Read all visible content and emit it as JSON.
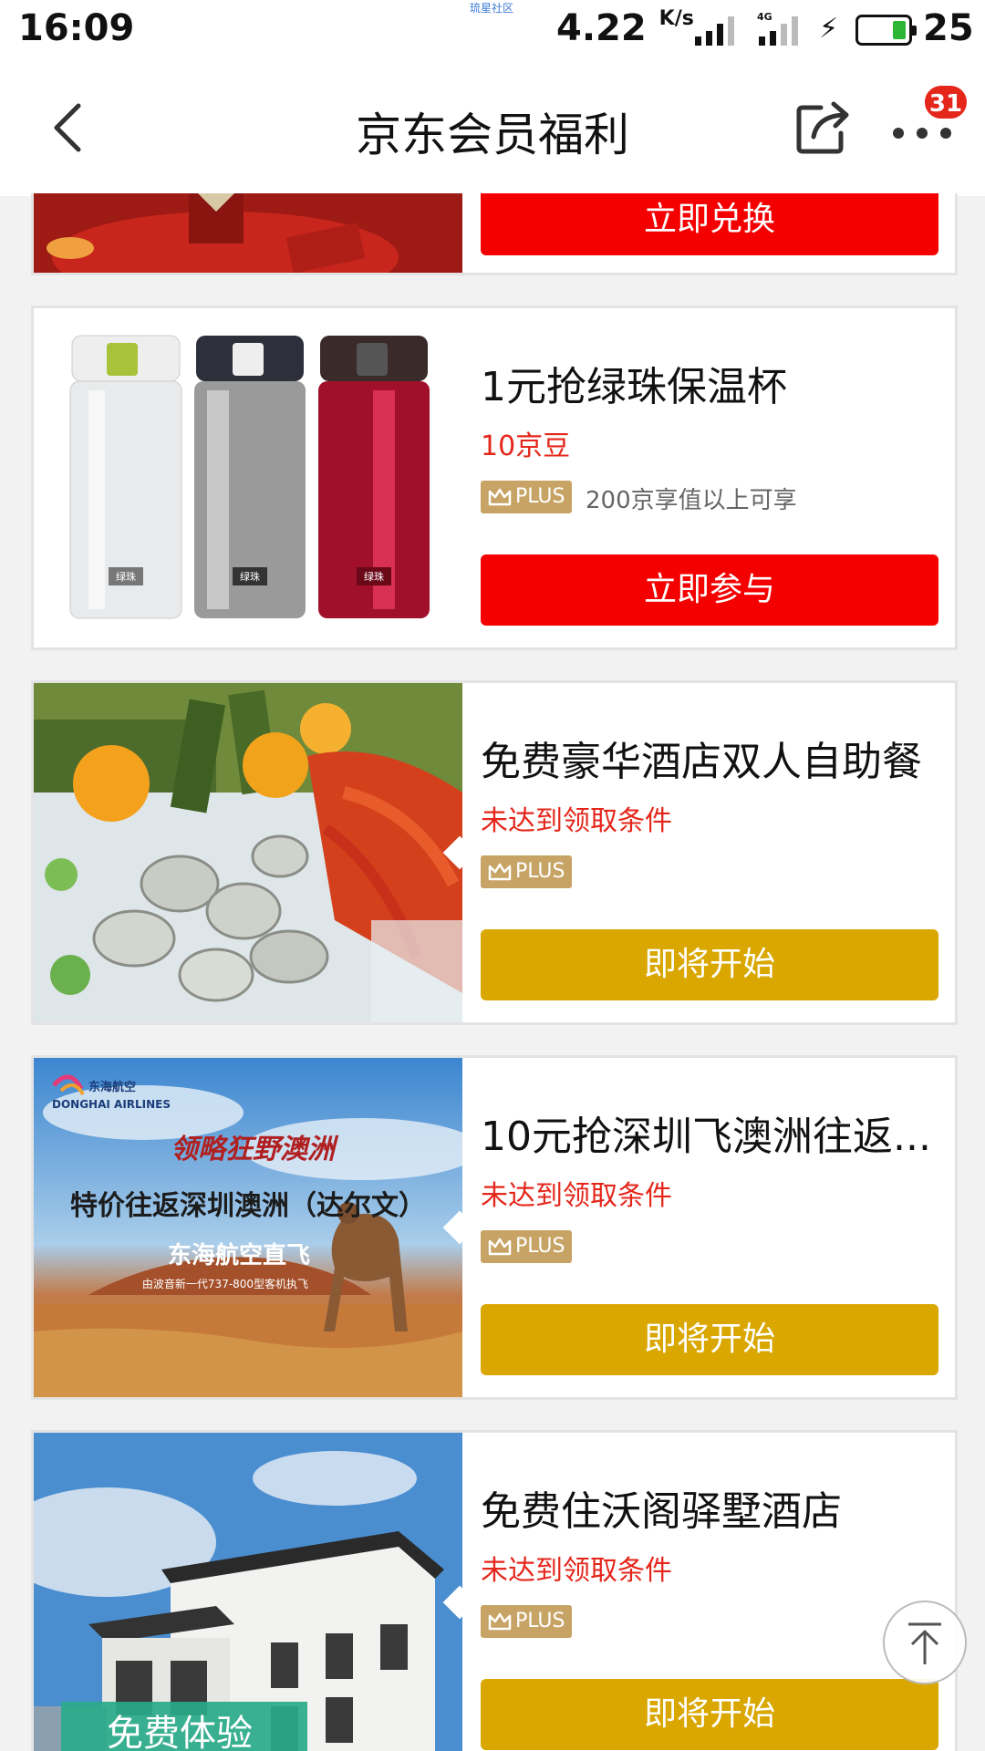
{
  "status_bar": {
    "time": "16:09",
    "center_text": "琉星社区",
    "speed_value": "4.22",
    "speed_unit": "K/s",
    "network": "4G",
    "battery_level": "25"
  },
  "nav": {
    "title": "京东会员福利",
    "badge_count": "31",
    "back_icon": "back-arrow-icon",
    "share_icon": "share-icon",
    "more_icon": "more-dots-icon"
  },
  "cards": [
    {
      "button_label": "立即兑换",
      "button_color": "#f50000"
    },
    {
      "title": "1元抢绿珠保温杯",
      "subtitle": "10京豆",
      "plus_label": "PLUS",
      "plus_note": "200京享值以上可享",
      "button_label": "立即参与",
      "image_texts": [
        "绿珠",
        "绿珠",
        "绿珠"
      ]
    },
    {
      "title": "免费豪华酒店双人自助餐",
      "subtitle": "未达到领取条件",
      "plus_label": "PLUS",
      "button_label": "即将开始"
    },
    {
      "title": "10元抢深圳飞澳洲往返...",
      "subtitle": "未达到领取条件",
      "plus_label": "PLUS",
      "button_label": "即将开始",
      "image_texts": {
        "airline_cn": "东海航空",
        "airline_en": "DONGHAI AIRLINES",
        "slogan": "领略狂野澳洲",
        "headline": "特价往返深圳澳洲（达尔文）",
        "subline": "东海航空直飞",
        "fine_print": "由波音新一代737-800型客机执飞"
      }
    },
    {
      "title": "免费住沃阁驿墅酒店",
      "subtitle": "未达到领取条件",
      "plus_label": "PLUS",
      "button_label": "即将开始",
      "image_texts": {
        "banner": "免费体验"
      }
    }
  ],
  "colors": {
    "accent_red": "#f50000",
    "accent_gold": "#d9a700",
    "plus_gold": "#c7a465",
    "warning_red": "#e4261b"
  },
  "fab": {
    "icon": "scroll-to-top-icon"
  }
}
